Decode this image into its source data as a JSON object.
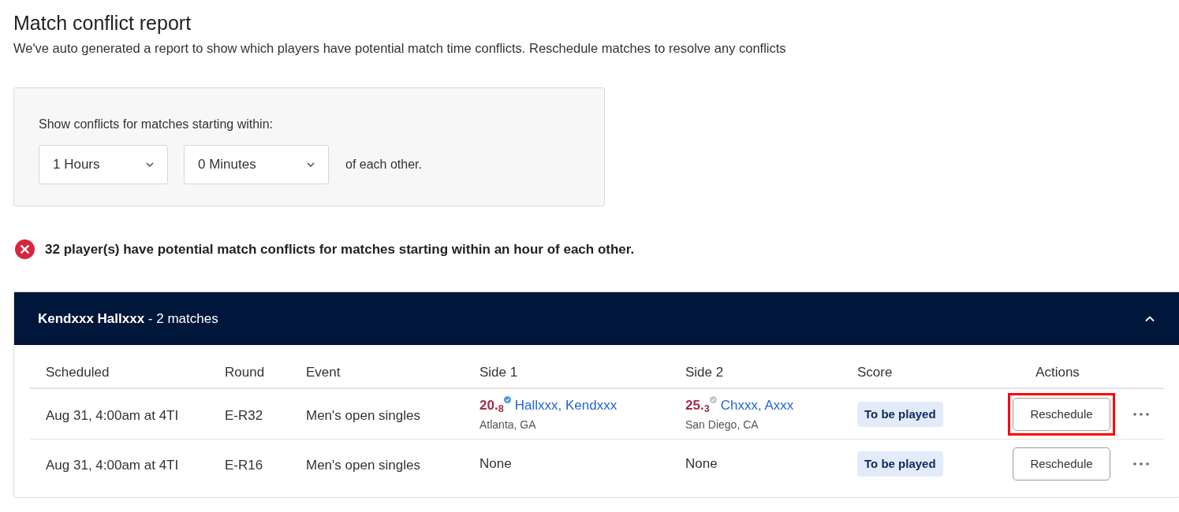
{
  "title": "Match conflict report",
  "subtitle": "We've auto generated a report to show which players have potential match time conflicts. Reschedule matches to resolve any conflicts",
  "filter": {
    "label": "Show conflicts for matches starting within:",
    "selects": [
      {
        "value": "1 Hours"
      },
      {
        "value": "0 Minutes"
      }
    ],
    "suffix": "of each other."
  },
  "alert": {
    "text": "32 player(s) have potential match conflicts for matches starting within an hour of each other."
  },
  "groups": [
    {
      "player": "Kendxxx Hallxxx",
      "count": "- 2 matches",
      "expanded": true,
      "columns": [
        "Scheduled",
        "Round",
        "Event",
        "Side 1",
        "Side 2",
        "Score",
        "Actions"
      ],
      "rows": [
        {
          "scheduled": "Aug 31, 4:00am at 4TI",
          "round": "E-R32",
          "event": "Men's open singles",
          "side1": {
            "kind": "player",
            "rating": "20.$_{8}$",
            "verified": true,
            "name": "Hallxxx, Kendxxx",
            "location": "Atlanta, GA"
          },
          "side2": {
            "kind": "player",
            "rating": "25.$_{3}$",
            "verified": false,
            "name": "Chxxx, Axxx",
            "location": "San Diego, CA"
          },
          "score": "To be played",
          "action": "Reschedule",
          "highlighted": true
        },
        {
          "scheduled": "Aug 31, 4:00am at 4TI",
          "round": "E-R16",
          "event": "Men's open singles",
          "side1": {
            "kind": "none",
            "text": "None"
          },
          "side2": {
            "kind": "none",
            "text": "None"
          },
          "score": "To be played",
          "action": "Reschedule",
          "highlighted": false
        }
      ]
    }
  ]
}
